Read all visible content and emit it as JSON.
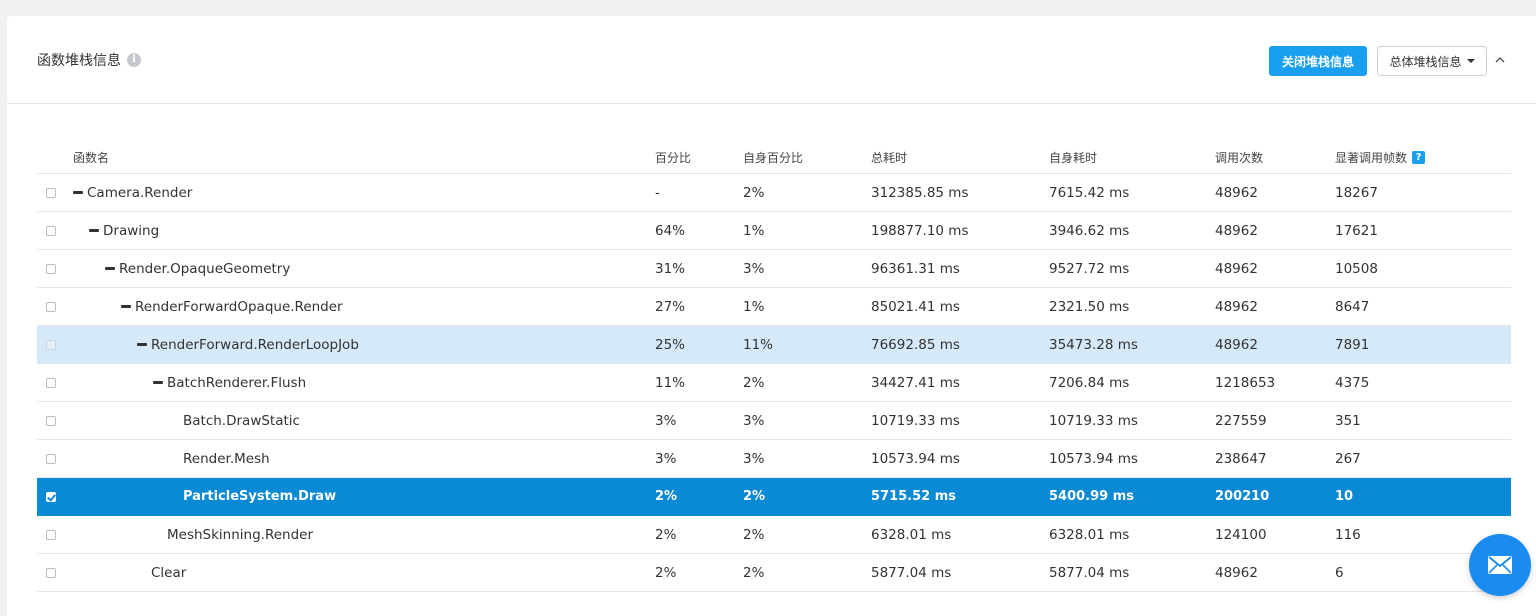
{
  "panel": {
    "title": "函数堆栈信息",
    "close_button": "关闭堆栈信息",
    "dropdown_label": "总体堆栈信息"
  },
  "table": {
    "columns": [
      "函数名",
      "百分比",
      "自身百分比",
      "总耗时",
      "自身耗时",
      "调用次数",
      "显著调用帧数"
    ],
    "rows": [
      {
        "name": "Camera.Render",
        "pct": "-",
        "self_pct": "2%",
        "total": "312385.85 ms",
        "self_time": "7615.42 ms",
        "calls": "48962",
        "frames": "18267",
        "depth": 0,
        "expanded": true,
        "checked": false,
        "state": "normal"
      },
      {
        "name": "Drawing",
        "pct": "64%",
        "self_pct": "1%",
        "total": "198877.10 ms",
        "self_time": "3946.62 ms",
        "calls": "48962",
        "frames": "17621",
        "depth": 1,
        "expanded": true,
        "checked": false,
        "state": "normal"
      },
      {
        "name": "Render.OpaqueGeometry",
        "pct": "31%",
        "self_pct": "3%",
        "total": "96361.31 ms",
        "self_time": "9527.72 ms",
        "calls": "48962",
        "frames": "10508",
        "depth": 2,
        "expanded": true,
        "checked": false,
        "state": "normal"
      },
      {
        "name": "RenderForwardOpaque.Render",
        "pct": "27%",
        "self_pct": "1%",
        "total": "85021.41 ms",
        "self_time": "2321.50 ms",
        "calls": "48962",
        "frames": "8647",
        "depth": 3,
        "expanded": true,
        "checked": false,
        "state": "normal"
      },
      {
        "name": "RenderForward.RenderLoopJob",
        "pct": "25%",
        "self_pct": "11%",
        "total": "76692.85 ms",
        "self_time": "35473.28 ms",
        "calls": "48962",
        "frames": "7891",
        "depth": 4,
        "expanded": true,
        "checked": false,
        "state": "hover"
      },
      {
        "name": "BatchRenderer.Flush",
        "pct": "11%",
        "self_pct": "2%",
        "total": "34427.41 ms",
        "self_time": "7206.84 ms",
        "calls": "1218653",
        "frames": "4375",
        "depth": 5,
        "expanded": true,
        "checked": false,
        "state": "normal"
      },
      {
        "name": "Batch.DrawStatic",
        "pct": "3%",
        "self_pct": "3%",
        "total": "10719.33 ms",
        "self_time": "10719.33 ms",
        "calls": "227559",
        "frames": "351",
        "depth": 6,
        "expanded": false,
        "checked": false,
        "state": "normal"
      },
      {
        "name": "Render.Mesh",
        "pct": "3%",
        "self_pct": "3%",
        "total": "10573.94 ms",
        "self_time": "10573.94 ms",
        "calls": "238647",
        "frames": "267",
        "depth": 6,
        "expanded": false,
        "checked": false,
        "state": "normal"
      },
      {
        "name": "ParticleSystem.Draw",
        "pct": "2%",
        "self_pct": "2%",
        "total": "5715.52 ms",
        "self_time": "5400.99 ms",
        "calls": "200210",
        "frames": "10",
        "depth": 6,
        "expanded": false,
        "checked": true,
        "state": "selected"
      },
      {
        "name": "MeshSkinning.Render",
        "pct": "2%",
        "self_pct": "2%",
        "total": "6328.01 ms",
        "self_time": "6328.01 ms",
        "calls": "124100",
        "frames": "116",
        "depth": 5,
        "expanded": false,
        "checked": false,
        "state": "normal"
      },
      {
        "name": "Clear",
        "pct": "2%",
        "self_pct": "2%",
        "total": "5877.04 ms",
        "self_time": "5877.04 ms",
        "calls": "48962",
        "frames": "6",
        "depth": 4,
        "expanded": false,
        "checked": false,
        "state": "normal"
      }
    ]
  },
  "colors": {
    "primary": "#1a9ff0",
    "selected_row": "#0a89d4",
    "hover_row": "#d6e9f8"
  },
  "icons": {
    "title_info": "info-icon",
    "collapse": "chevron-up-icon",
    "help": "question-icon",
    "fab": "mail-icon"
  }
}
